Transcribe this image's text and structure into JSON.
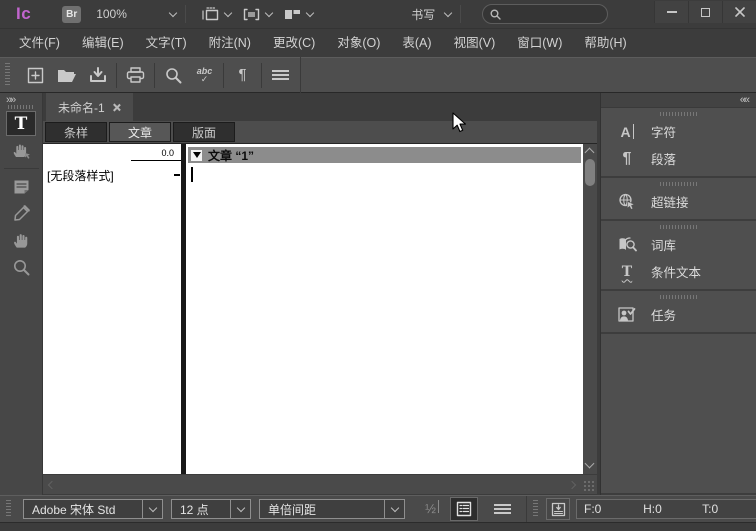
{
  "colors": {
    "logo_accent": "#c265ce",
    "paper": "#ffffff",
    "story_header_bg": "#8c8c8c",
    "ui_dark": "#3c3c3c",
    "ui_mid": "#4f4f4f"
  },
  "titlebar": {
    "logo": "Ic",
    "bridge": "Br",
    "zoom": "100%",
    "workspace": "书写",
    "search_value": ""
  },
  "menubar": {
    "items": [
      {
        "label": "文件(F)"
      },
      {
        "label": "编辑(E)"
      },
      {
        "label": "文字(T)"
      },
      {
        "label": "附注(N)"
      },
      {
        "label": "更改(C)"
      },
      {
        "label": "对象(O)"
      },
      {
        "label": "表(A)"
      },
      {
        "label": "视图(V)"
      },
      {
        "label": "窗口(W)"
      },
      {
        "label": "帮助(H)"
      }
    ]
  },
  "document_tab": {
    "label": "未命名-1"
  },
  "view_tabs": {
    "items": [
      {
        "label": "条样"
      },
      {
        "label": "文章"
      },
      {
        "label": "版面"
      }
    ],
    "active": "文章"
  },
  "galley": {
    "depth": "0.0",
    "style_label": "[无段落样式]"
  },
  "story": {
    "title": "文章 “1”"
  },
  "dock": {
    "groups": [
      {
        "items": [
          {
            "icon": "character-icon",
            "label": "字符"
          },
          {
            "icon": "paragraph-icon",
            "label": "段落"
          }
        ]
      },
      {
        "items": [
          {
            "icon": "hyperlink-icon",
            "label": "超链接"
          }
        ]
      },
      {
        "items": [
          {
            "icon": "thesaurus-icon",
            "label": "词库"
          },
          {
            "icon": "conditional-text-icon",
            "label": "条件文本"
          }
        ]
      },
      {
        "items": [
          {
            "icon": "assignments-icon",
            "label": "任务"
          }
        ]
      }
    ]
  },
  "statusbar": {
    "font_family": "Adobe 宋体 Std",
    "font_size": "12 点",
    "leading": "单倍间距",
    "counters": [
      {
        "value": "F:0"
      },
      {
        "value": "H:0"
      },
      {
        "value": "T:0"
      }
    ]
  }
}
